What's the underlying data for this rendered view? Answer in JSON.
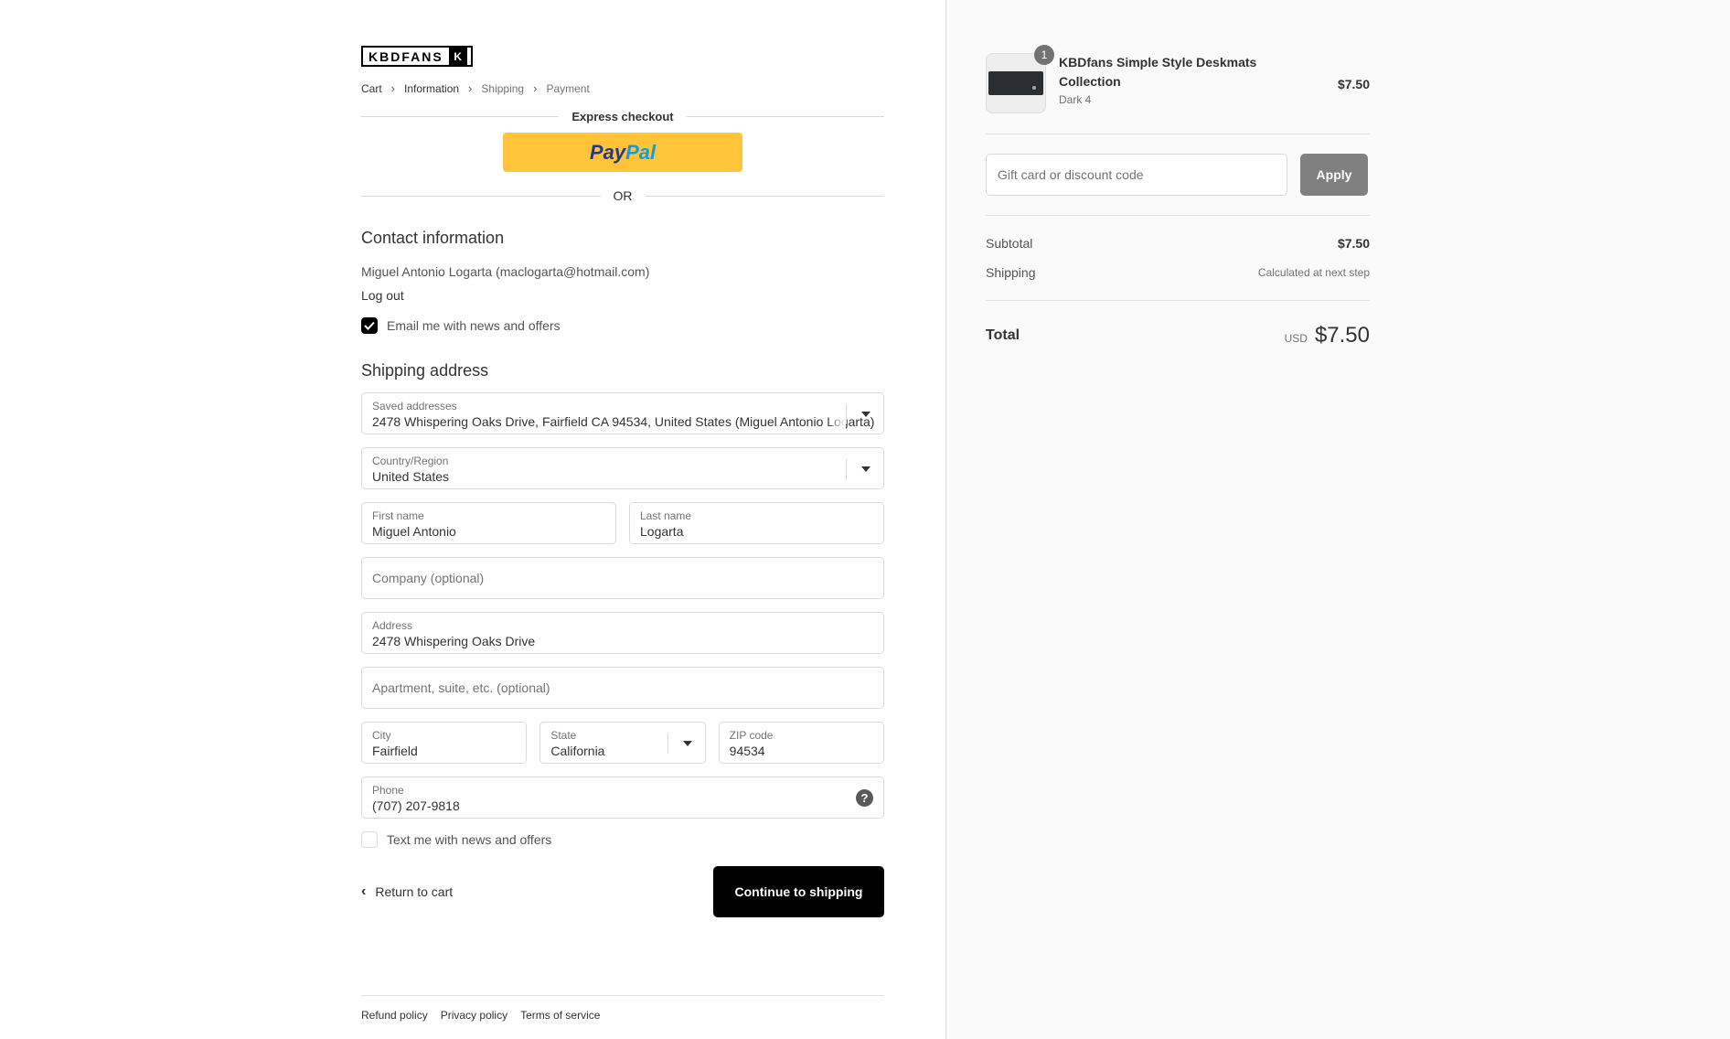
{
  "brand": {
    "logo_text": "KBDFANS",
    "logo_mark": "K"
  },
  "breadcrumb": [
    {
      "label": "Cart"
    },
    {
      "label": "Information"
    },
    {
      "label": "Shipping"
    },
    {
      "label": "Payment"
    }
  ],
  "express": {
    "title": "Express checkout",
    "paypal_part1": "Pay",
    "paypal_part2": "Pal",
    "or_label": "OR"
  },
  "contact": {
    "heading": "Contact information",
    "account_line": "Miguel Antonio Logarta (maclogarta@hotmail.com)",
    "logout_label": "Log out",
    "email_opt_label": "Email me with news and offers",
    "email_opt_checked": true
  },
  "shipping": {
    "heading": "Shipping address",
    "saved_addresses": {
      "label": "Saved addresses",
      "value": "2478 Whispering Oaks Drive, Fairfield CA 94534, United States (Miguel Antonio Logarta)"
    },
    "country": {
      "label": "Country/Region",
      "value": "United States"
    },
    "first_name": {
      "label": "First name",
      "value": "Miguel Antonio"
    },
    "last_name": {
      "label": "Last name",
      "value": "Logarta"
    },
    "company": {
      "placeholder": "Company (optional)"
    },
    "address": {
      "label": "Address",
      "value": "2478 Whispering Oaks Drive"
    },
    "apartment": {
      "placeholder": "Apartment, suite, etc. (optional)"
    },
    "city": {
      "label": "City",
      "value": "Fairfield"
    },
    "state": {
      "label": "State",
      "value": "California"
    },
    "zip": {
      "label": "ZIP code",
      "value": "94534"
    },
    "phone": {
      "label": "Phone",
      "value": "(707) 207-9818",
      "help_glyph": "?"
    },
    "sms_opt_label": "Text me with news and offers",
    "sms_opt_checked": false
  },
  "actions": {
    "return_label": "Return to cart",
    "continue_label": "Continue to shipping"
  },
  "footer": {
    "links": [
      "Refund policy",
      "Privacy policy",
      "Terms of service"
    ]
  },
  "summary": {
    "product": {
      "quantity": "1",
      "name": "KBDfans Simple Style Deskmats Collection",
      "variant": "Dark 4",
      "price": "$7.50"
    },
    "discount": {
      "placeholder": "Gift card or discount code",
      "apply_label": "Apply"
    },
    "subtotal": {
      "label": "Subtotal",
      "value": "$7.50"
    },
    "shipping": {
      "label": "Shipping",
      "value": "Calculated at next step"
    },
    "total": {
      "label": "Total",
      "currency": "USD",
      "value": "$7.50"
    }
  },
  "colors": {
    "primary_button": "#000000",
    "paypal_yellow": "#ffc439",
    "apply_button": "#808080",
    "summary_background": "#fafafa"
  }
}
